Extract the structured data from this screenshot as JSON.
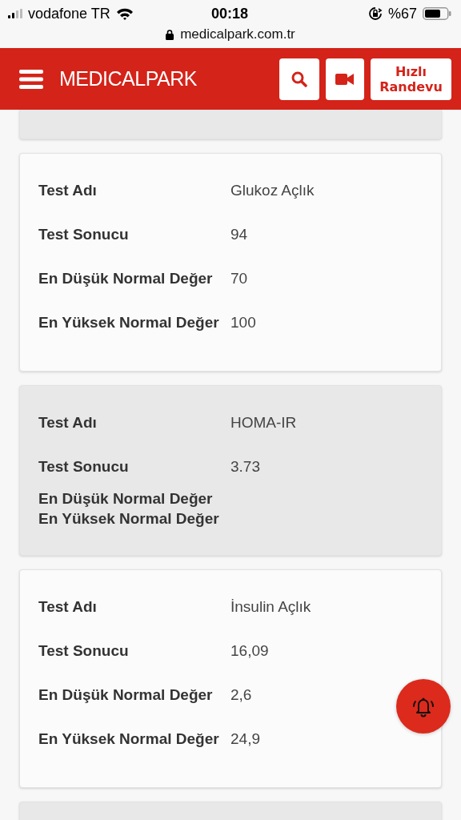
{
  "status_bar": {
    "carrier": "vodafone TR",
    "time": "00:18",
    "battery": "%67"
  },
  "address_bar": {
    "url": "medicalpark.com.tr"
  },
  "header": {
    "logo": "MEDICALPARK",
    "appointment_button": "Hızlı Randevu"
  },
  "cards": [
    {
      "shaded": true
    },
    {
      "shaded": false,
      "rows": [
        {
          "label": "Test Adı",
          "value": "Glukoz Açlık"
        },
        {
          "label": "Test Sonucu",
          "value": "94"
        },
        {
          "label": "En Düşük Normal Değer",
          "value": "70"
        },
        {
          "label": "En Yüksek Normal Değer",
          "value": "100"
        }
      ]
    },
    {
      "shaded": true,
      "rows": [
        {
          "label": "Test Adı",
          "value": "HOMA-IR"
        },
        {
          "label": "Test Sonucu",
          "value": "3.73"
        },
        {
          "label": "En Düşük Normal Değer"
        },
        {
          "label": "En Yüksek Normal Değer"
        }
      ]
    },
    {
      "shaded": false,
      "rows": [
        {
          "label": "Test Adı",
          "value": "İnsulin Açlık"
        },
        {
          "label": "Test Sonucu",
          "value": "16,09"
        },
        {
          "label": "En Düşük Normal Değer",
          "value": "2,6"
        },
        {
          "label": "En Yüksek Normal Değer",
          "value": "24,9"
        }
      ]
    },
    {
      "shaded": true
    }
  ]
}
